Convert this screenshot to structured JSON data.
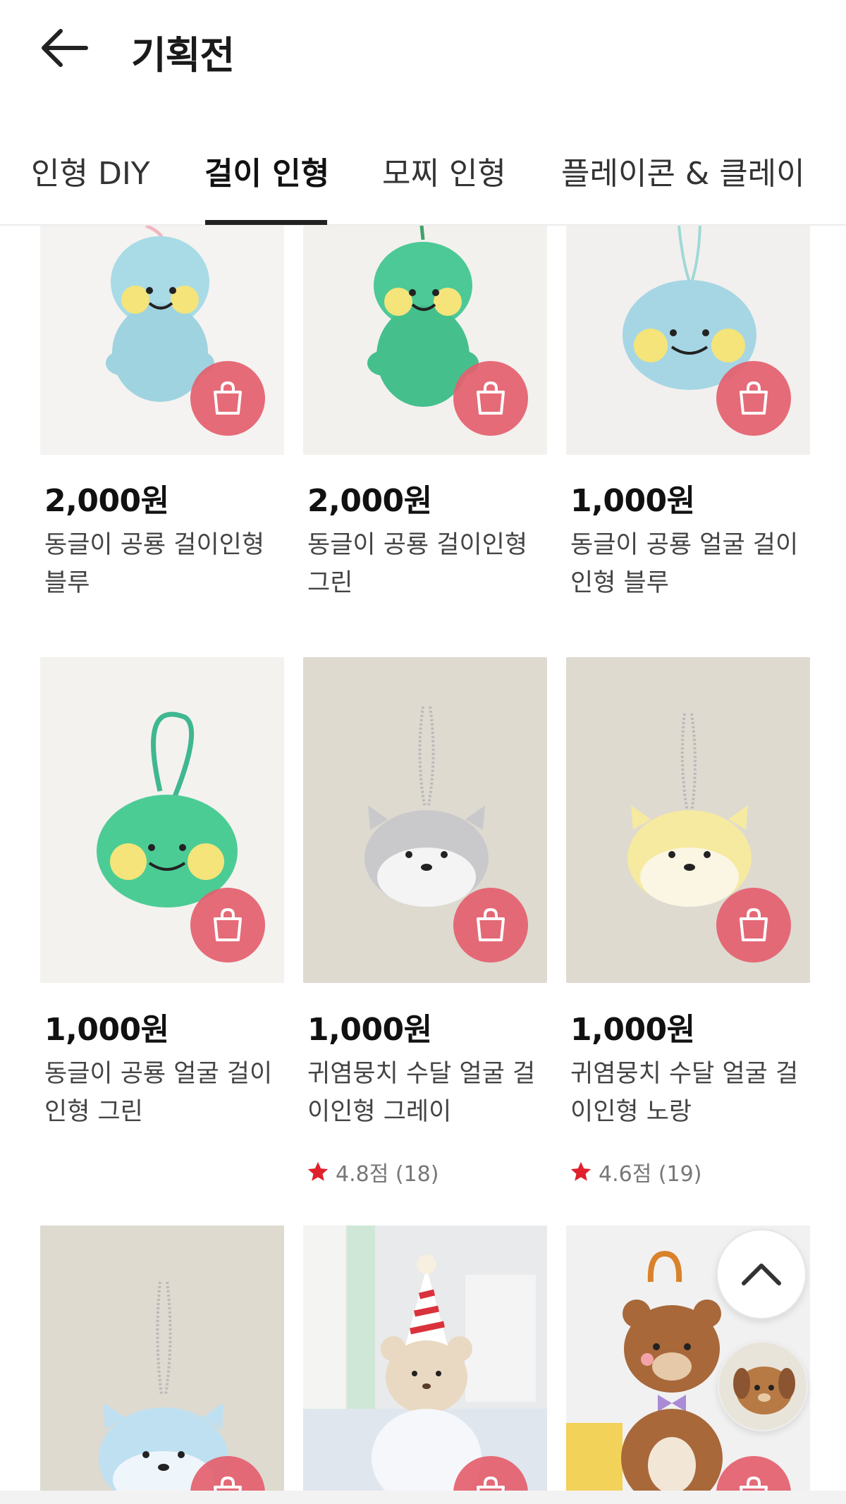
{
  "header": {
    "title": "기획전",
    "back_icon": "arrow-left-icon"
  },
  "tabs": [
    {
      "label": "인형 DIY",
      "active": false
    },
    {
      "label": "걸이 인형",
      "active": true
    },
    {
      "label": "모찌 인형",
      "active": false
    },
    {
      "label": "플레이콘 & 클레이",
      "active": false
    }
  ],
  "products": [
    {
      "price": "2,000원",
      "name": "동글이 공룡 걸이인형 블루"
    },
    {
      "price": "2,000원",
      "name": "동글이 공룡 걸이인형 그린"
    },
    {
      "price": "1,000원",
      "name": "동글이 공룡 얼굴 걸이인형 블루"
    },
    {
      "price": "1,000원",
      "name": "동글이 공룡 얼굴 걸이인형 그린"
    },
    {
      "price": "1,000원",
      "name": "귀염뭉치 수달 얼굴 걸이인형 그레이",
      "rating": "4.8점 (18)"
    },
    {
      "price": "1,000원",
      "name": "귀염뭉치 수달 얼굴 걸이인형 노랑",
      "rating": "4.6점 (19)"
    }
  ],
  "colors": {
    "cart_button": "#e4606e",
    "rating_star": "#e0202d",
    "active_tab": "#222222"
  },
  "icons": {
    "cart": "shopping-bag-icon",
    "scroll_top": "chevron-up-icon",
    "rating": "star-icon"
  }
}
